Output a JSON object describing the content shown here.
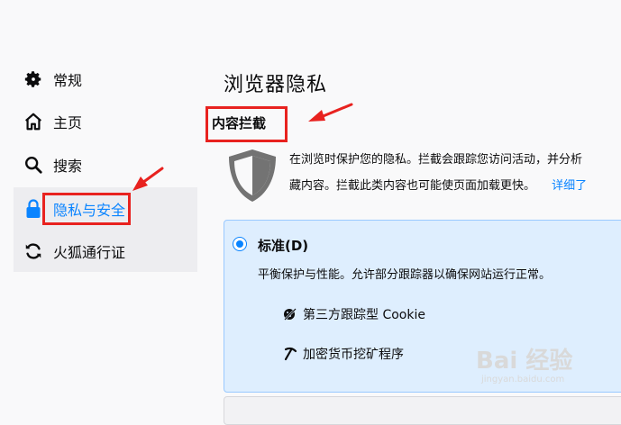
{
  "sidebar": {
    "items": [
      {
        "label": "常规",
        "icon": "gear-icon"
      },
      {
        "label": "主页",
        "icon": "home-icon"
      },
      {
        "label": "搜索",
        "icon": "search-icon"
      },
      {
        "label": "隐私与安全",
        "icon": "lock-icon",
        "selected": true
      },
      {
        "label": "火狐通行证",
        "icon": "sync-icon"
      }
    ]
  },
  "main": {
    "title": "浏览器隐私",
    "section_title": "内容拦截",
    "description_line1": "在浏览时保护您的隐私。拦截会跟踪您访问活动，并分析",
    "description_line2": "藏内容。拦截此类内容也可能使页面加载更快。",
    "learn_more": "详细了",
    "standard": {
      "label": "标准(D)",
      "description": "平衡保护与性能。允许部分跟踪器以确保网站运行正常。",
      "features": [
        {
          "label": "第三方跟踪型 Cookie",
          "icon": "cookie-blocked-icon"
        },
        {
          "label": "加密货币挖矿程序",
          "icon": "cryptominer-icon"
        }
      ]
    }
  },
  "watermark": {
    "text": "Bai 经验",
    "sub": "jingyan.baidu.com"
  },
  "colors": {
    "accent": "#0a84ff",
    "annotation_red": "#e8221f"
  }
}
